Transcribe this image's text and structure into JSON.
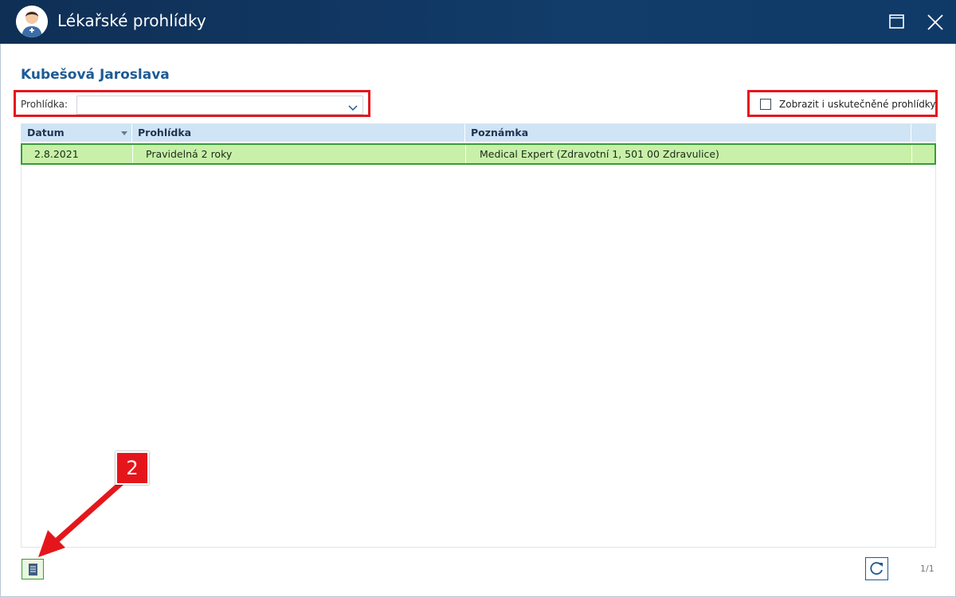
{
  "window": {
    "title": "Lékařské prohlídky"
  },
  "patient": {
    "name": "Kubešová Jaroslava"
  },
  "filter": {
    "label": "Prohlídka:",
    "value": "",
    "show_completed_label": "Zobrazit i uskutečněné prohlídky",
    "show_completed_checked": false
  },
  "table": {
    "columns": [
      "Datum",
      "Prohlídka",
      "Poznámka"
    ],
    "rows": [
      {
        "datum": "2.8.2021",
        "prohlidka": "Pravidelná 2 roky",
        "poznamka": "Medical Expert (Zdravotní 1, 501 00 Zdravulice)"
      }
    ],
    "selected_row_color": "#c8f0a8"
  },
  "annotation": {
    "badge": "2",
    "color": "#e4161c"
  },
  "footer": {
    "pager": "1/1"
  },
  "icons": {
    "avatar": "doctor-avatar-icon",
    "maximize": "maximize-icon",
    "close": "close-icon",
    "dropdown": "chevron-down-icon",
    "sort": "sort-down-icon",
    "document": "document-icon",
    "refresh": "refresh-icon"
  }
}
